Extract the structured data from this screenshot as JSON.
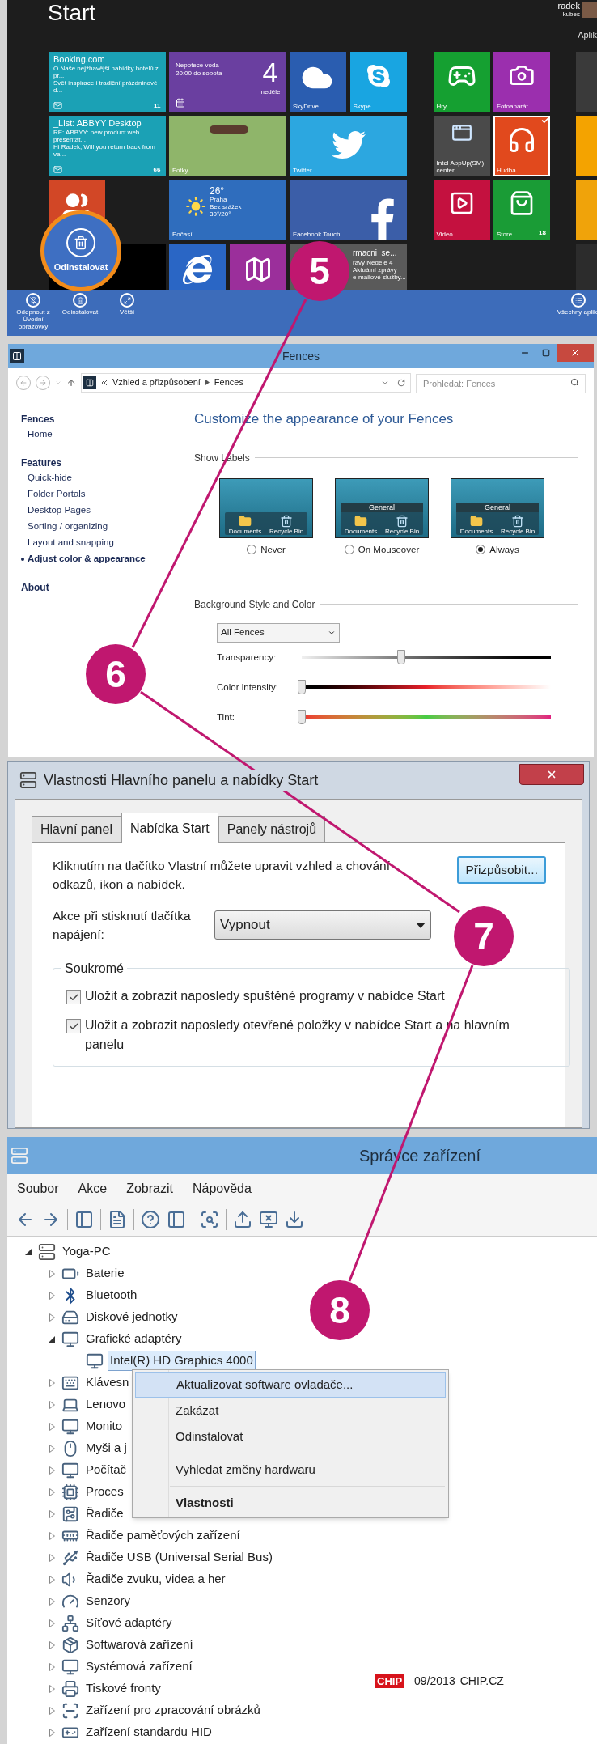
{
  "callouts": [
    {
      "number": "5"
    },
    {
      "number": "6"
    },
    {
      "number": "7"
    },
    {
      "number": "8"
    }
  ],
  "start_screen": {
    "title": "Start",
    "user": {
      "first_name": "radek",
      "last_name": "kubes"
    },
    "group_heading": "Aplik",
    "tiles": [
      {
        "kind": "mail",
        "color": "#1ba1b5",
        "title": "Booking.com",
        "lines": [
          "O Naše nejžhavější nabídky hotelů z pr...",
          "Svět inspirace i tradiční prázdninové d..."
        ],
        "badge": "11"
      },
      {
        "kind": "calendar",
        "color": "#6a3fa0",
        "title": "Nepotece voda",
        "lines": [
          "20:00 do sobota"
        ],
        "day": "4",
        "weekday": "neděle"
      },
      {
        "kind": "skydrive",
        "color": "#2a5db0",
        "label": "SkyDrive"
      },
      {
        "kind": "skype",
        "color": "#19a5e1",
        "label": "Skype"
      },
      {
        "kind": "mail",
        "color": "#1ba1b5",
        "title": "_List: ABBYY Desktop",
        "lines": [
          "RE: ABBYY: new product web presentat...",
          "Hi Radek, Will you return back from va..."
        ],
        "badge": "66"
      },
      {
        "kind": "photos",
        "label": "Fotky"
      },
      {
        "kind": "twitter",
        "color": "#2ca7e0",
        "label": "Twitter"
      },
      {
        "kind": "people",
        "color": "#d24726"
      },
      {
        "kind": "weather",
        "color": "#2f6dbd",
        "temperature": "26°",
        "lines": [
          "Praha",
          "Bez srážek",
          "30°/20°"
        ],
        "label": "Počasí"
      },
      {
        "kind": "facebook",
        "color": "#3b5ea8",
        "label": "Facebook Touch"
      },
      {
        "kind": "blank",
        "color": "#000000"
      },
      {
        "kind": "ie",
        "color": "#2a66c5"
      },
      {
        "kind": "maps",
        "color": "#9b2f9b"
      },
      {
        "kind": "news",
        "color": "#5a5a5a",
        "title": "rmacni_se...",
        "lines": [
          "rávy Neděle 4",
          "Aktuální zprávy",
          "e-mailové služby..."
        ]
      }
    ],
    "tiles_right": [
      {
        "kind": "games",
        "color": "#15a031",
        "label": "Hry",
        "selected": false
      },
      {
        "kind": "camera",
        "color": "#9b2fae",
        "label": "Fotoaparát",
        "selected": false
      },
      {
        "kind": "app",
        "color": "#4a4a4a",
        "label": "Intel AppUp(SM) center",
        "selected": false
      },
      {
        "kind": "music",
        "color": "#e1491d",
        "label": "Hudba",
        "selected": true
      },
      {
        "kind": "video",
        "color": "#c4113f",
        "label": "Video",
        "selected": false
      },
      {
        "kind": "store",
        "color": "#1a9c36",
        "label": "Store",
        "badge": "18",
        "selected": false
      }
    ],
    "uninstall_bubble": {
      "label": "Odinstalovat"
    },
    "app_bar": {
      "buttons": [
        {
          "label": "Odepnout z Úvodní obrazovky"
        },
        {
          "label": "Odinstalovat"
        },
        {
          "label": "Větší"
        }
      ],
      "all_apps": "Všechny aplik"
    }
  },
  "fences": {
    "title": "Fences",
    "breadcrumb": [
      "Vzhled a přizpůsobení",
      "Fences"
    ],
    "search_placeholder": "Prohledat: Fences",
    "sidebar": [
      {
        "title": "Fences",
        "items": [
          {
            "label": "Home",
            "selected": false
          }
        ]
      },
      {
        "title": "Features",
        "items": [
          {
            "label": "Quick-hide",
            "selected": false
          },
          {
            "label": "Folder Portals",
            "selected": false
          },
          {
            "label": "Desktop Pages",
            "selected": false
          },
          {
            "label": "Sorting / organizing",
            "selected": false
          },
          {
            "label": "Layout and snapping",
            "selected": false
          },
          {
            "label": "Adjust color & appearance",
            "selected": true
          }
        ]
      },
      {
        "title": "About"
      }
    ],
    "heading": "Customize the appearance of your Fences",
    "show_labels": {
      "title": "Show Labels",
      "options": [
        {
          "label": "Never",
          "selected": false,
          "icons": [
            "Documents",
            "Recycle Bin"
          ]
        },
        {
          "label": "On Mouseover",
          "selected": false,
          "header": "General",
          "icons": [
            "Documents",
            "Recycle Bin"
          ]
        },
        {
          "label": "Always",
          "selected": true,
          "header": "General",
          "icons": [
            "Documents",
            "Recycle Bin"
          ]
        }
      ]
    },
    "background": {
      "title": "Background Style and Color",
      "select": "All Fences",
      "sliders": [
        {
          "kind": "gray",
          "label": "Transparency:",
          "level": 0.4
        },
        {
          "kind": "red",
          "label": "Color intensity:",
          "level": 0
        },
        {
          "kind": "rainbow",
          "label": "Tint:",
          "level": 0
        }
      ]
    }
  },
  "taskbar_properties": {
    "title": "Vlastnosti Hlavního panelu a nabídky Start",
    "tabs": [
      {
        "label": "Hlavní panel",
        "selected": false
      },
      {
        "label": "Nabídka Start",
        "selected": true
      },
      {
        "label": "Panely nástrojů",
        "selected": false
      }
    ],
    "description": "Kliknutím na tlačítko Vlastní můžete upravit vzhled a chování odkazů, ikon a nabídek.",
    "customize_button": "Přizpůsobit...",
    "power_label": "Akce při stisknutí tlačítka napájení:",
    "power_value": "Vypnout",
    "privacy": {
      "title": "Soukromé",
      "options": [
        {
          "label": "Uložit a zobrazit naposledy spuštěné programy v nabídce Start",
          "checked": true
        },
        {
          "label": "Uložit a zobrazit naposledy otevřené položky v nabídce Start a na hlavním panelu",
          "checked": true
        }
      ]
    }
  },
  "device_manager": {
    "title": "Správce zařízení",
    "menu": [
      "Soubor",
      "Akce",
      "Zobrazit",
      "Nápověda"
    ],
    "tree": {
      "label": "Yoga-PC",
      "expanded": true,
      "selected": false,
      "children": [
        {
          "label": "Baterie",
          "expanded": false,
          "selected": false
        },
        {
          "label": "Bluetooth",
          "expanded": false,
          "selected": false
        },
        {
          "label": "Diskové jednotky",
          "expanded": false,
          "selected": false
        },
        {
          "label": "Grafické adaptéry",
          "expanded": true,
          "selected": false,
          "children": [
            {
              "label": "Intel(R) HD Graphics 4000",
              "selected": true
            }
          ]
        },
        {
          "label": "Klávesn",
          "expanded": false,
          "selected": false
        },
        {
          "label": "Lenovo",
          "expanded": false,
          "selected": false
        },
        {
          "label": "Monito",
          "expanded": false,
          "selected": false
        },
        {
          "label": "Myši a j",
          "expanded": false,
          "selected": false
        },
        {
          "label": "Počítač",
          "expanded": false,
          "selected": false
        },
        {
          "label": "Proces",
          "expanded": false,
          "selected": false
        },
        {
          "label": "Řadiče",
          "expanded": false,
          "selected": false
        },
        {
          "label": "Řadiče paměťových zařízení",
          "expanded": false,
          "selected": false
        },
        {
          "label": "Řadiče USB (Universal Serial Bus)",
          "expanded": false,
          "selected": false
        },
        {
          "label": "Řadiče zvuku, videa a her",
          "expanded": false,
          "selected": false
        },
        {
          "label": "Senzory",
          "expanded": false,
          "selected": false
        },
        {
          "label": "Síťové adaptéry",
          "expanded": false,
          "selected": false
        },
        {
          "label": "Softwarová zařízení",
          "expanded": false,
          "selected": false
        },
        {
          "label": "Systémová zařízení",
          "expanded": false,
          "selected": false
        },
        {
          "label": "Tiskové fronty",
          "expanded": false,
          "selected": false
        },
        {
          "label": "Zařízení pro zpracování obrázků",
          "expanded": false,
          "selected": false
        },
        {
          "label": "Zařízení standardu HID",
          "expanded": false,
          "selected": false
        }
      ]
    },
    "context_menu": [
      {
        "kind": "item",
        "label": "Aktualizovat software ovladače...",
        "selected": true,
        "default": false
      },
      {
        "kind": "item",
        "label": "Zakázat",
        "selected": false,
        "default": false
      },
      {
        "kind": "item",
        "label": "Odinstalovat",
        "selected": false,
        "default": false
      },
      {
        "kind": "separator"
      },
      {
        "kind": "item",
        "label": "Vyhledat změny hardwaru",
        "selected": false,
        "default": false
      },
      {
        "kind": "separator"
      },
      {
        "kind": "item",
        "label": "Vlastnosti",
        "selected": false,
        "default": true
      }
    ]
  },
  "footer": {
    "logo": "CHIP",
    "issue": "09/2013",
    "site": "CHIP.CZ"
  }
}
